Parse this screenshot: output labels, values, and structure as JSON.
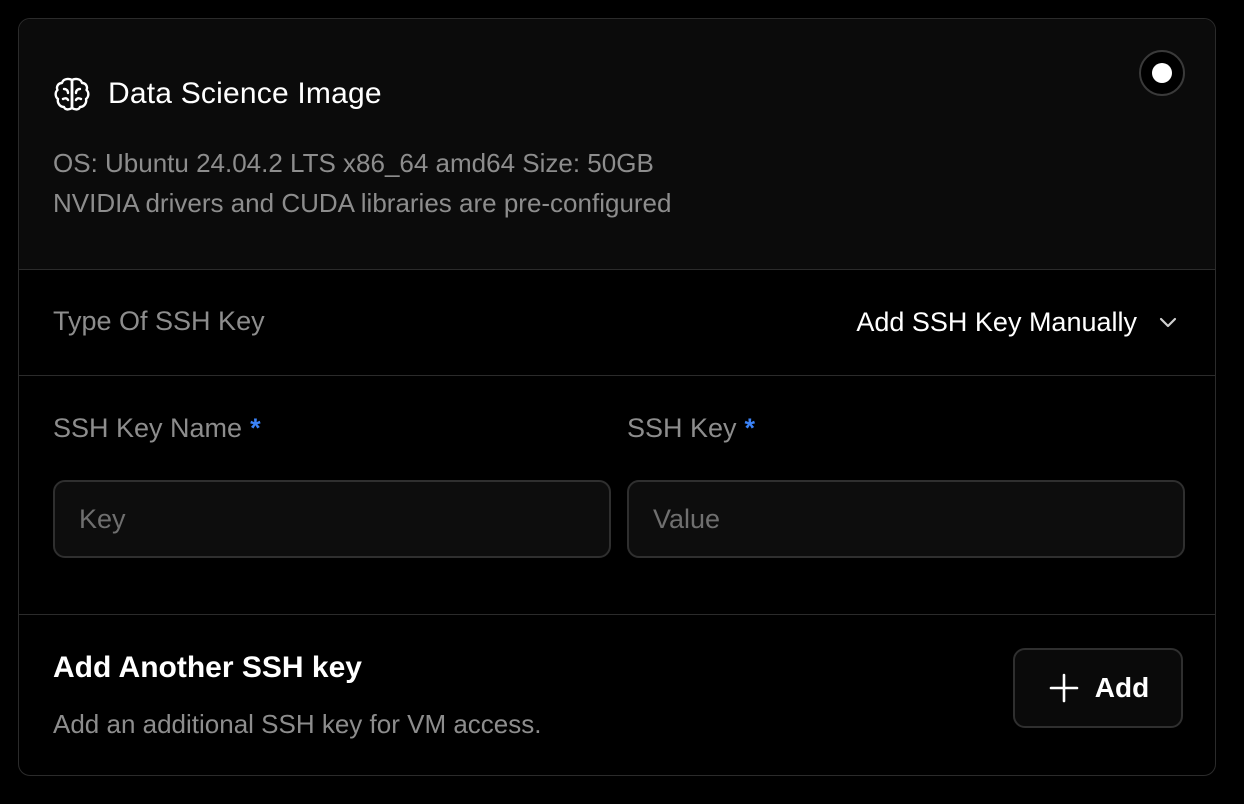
{
  "image_option": {
    "title": "Data Science Image",
    "icon": "brain-icon",
    "description_line1": "OS: Ubuntu 24.04.2 LTS x86_64 amd64 Size: 50GB",
    "description_line2": "NVIDIA drivers and CUDA libraries are pre-configured",
    "selected": true
  },
  "ssh_type": {
    "label": "Type Of SSH Key",
    "selected_value": "Add SSH Key Manually",
    "icon": "chevron-down-icon"
  },
  "fields": {
    "key_name": {
      "label": "SSH Key Name",
      "required_marker": "*",
      "value": "",
      "placeholder": "Key"
    },
    "key_value": {
      "label": "SSH Key",
      "required_marker": "*",
      "value": "",
      "placeholder": "Value"
    }
  },
  "add_another": {
    "title": "Add Another SSH key",
    "description": "Add an additional SSH key for VM access.",
    "button_label": "Add",
    "button_icon": "plus-icon"
  },
  "colors": {
    "background": "#000000",
    "panel": "#0b0b0b",
    "border": "#2b2b2b",
    "muted_text": "#8d8d8d",
    "required_accent": "#3b82f6"
  }
}
